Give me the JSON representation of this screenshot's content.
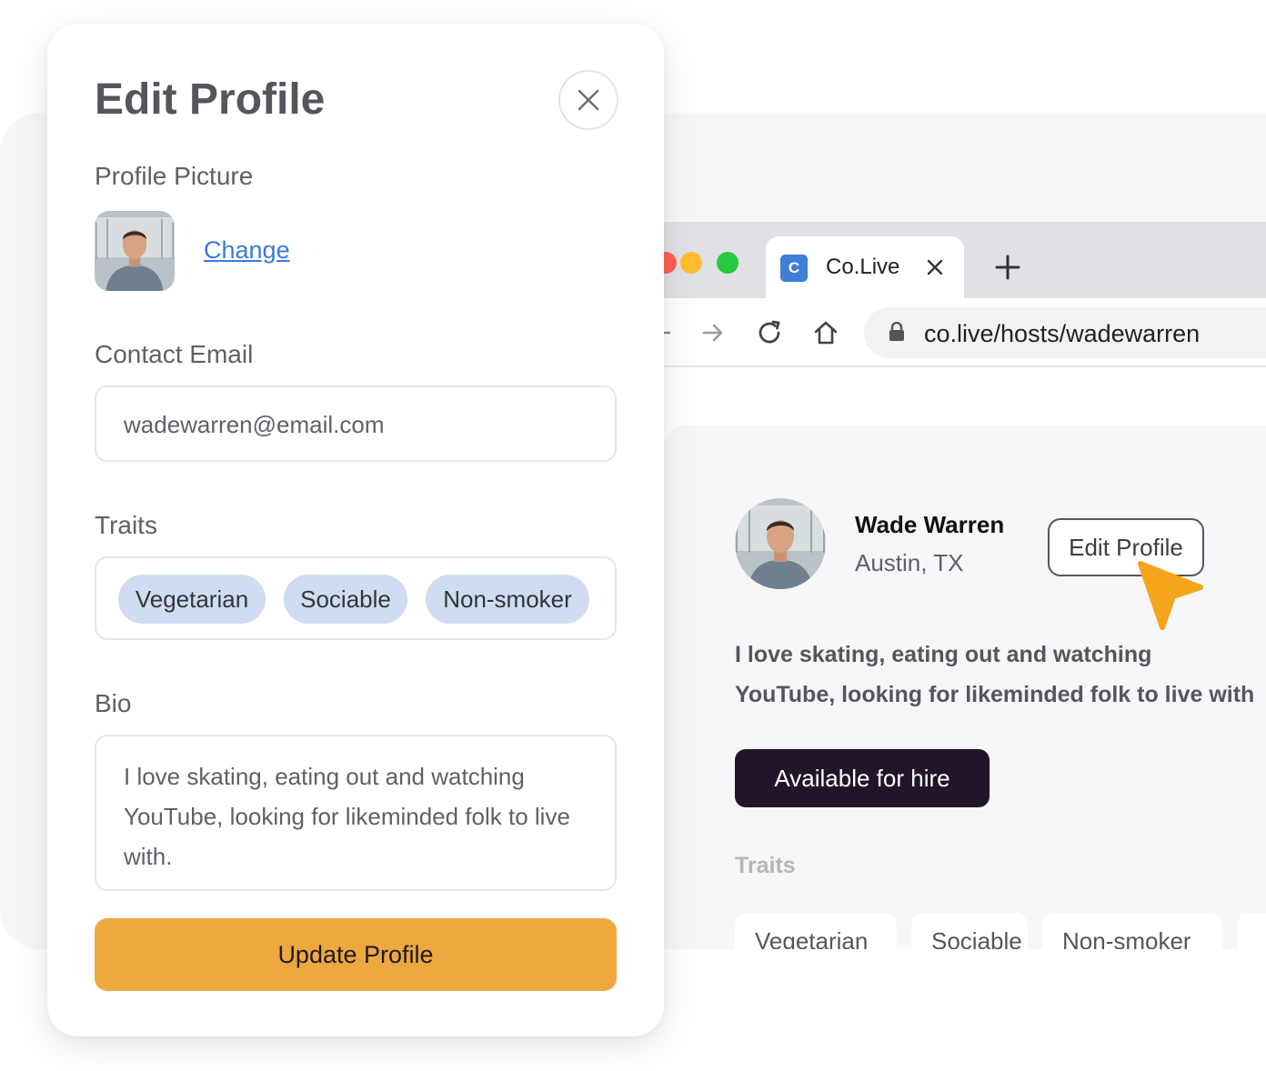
{
  "modal": {
    "title": "Edit Profile",
    "profile_picture_label": "Profile Picture",
    "change_link": "Change",
    "contact_email_label": "Contact Email",
    "email_value": "wadewarren@email.com",
    "traits_label": "Traits",
    "traits": [
      "Vegetarian",
      "Sociable",
      "Non-smoker"
    ],
    "bio_label": "Bio",
    "bio_value": "I love skating, eating out and watching YouTube, looking for likeminded folk to live with.",
    "update_button": "Update Profile"
  },
  "browser": {
    "tab_favicon_letter": "C",
    "tab_title": "Co.Live",
    "url": "co.live/hosts/wadewarren"
  },
  "page": {
    "name": "Wade Warren",
    "location": "Austin, TX",
    "edit_button": "Edit Profile",
    "bio_line1": "I love skating, eating out and watching",
    "bio_line2": "YouTube, looking for likeminded folk to live with",
    "hire_button": "Available for hire",
    "traits_label": "Traits",
    "traits": [
      "Vegetarian",
      "Sociable",
      "Non-smoker"
    ]
  },
  "colors": {
    "accent": "#eda83f",
    "link": "#3a7bd5",
    "chip": "#cfdcf1",
    "hire": "#22152a",
    "cursor": "#f5a51c"
  }
}
